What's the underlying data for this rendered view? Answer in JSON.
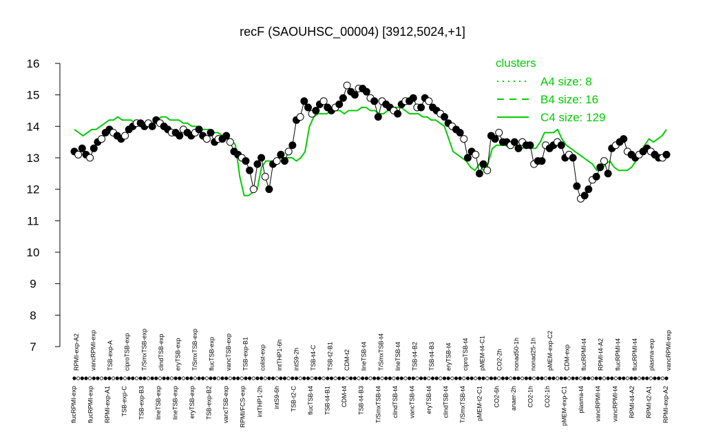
{
  "chart_data": {
    "type": "line",
    "title": "recF (SAOUHSC_00004) [3912,5024,+1]",
    "xlabel": "",
    "ylabel": "",
    "ylim": [
      7,
      16
    ],
    "yticks": [
      7,
      8,
      9,
      10,
      11,
      12,
      13,
      14,
      15,
      16
    ],
    "grid": false,
    "legend_position": "top-right",
    "legend": {
      "title": "clusters",
      "entries": [
        {
          "label": "A4 size: 8",
          "style": "dotted",
          "color": "#00cc00"
        },
        {
          "label": "B4 size: 16",
          "style": "dashed",
          "color": "#00cc00"
        },
        {
          "label": "C4 size: 129",
          "style": "solid",
          "color": "#00cc00"
        }
      ]
    },
    "colors": {
      "points_filled": "#000000",
      "points_open": "#ffffff",
      "line": "#000000",
      "cluster": "#00cc00"
    },
    "x_labels_top": [
      "RPMI-exp-A2",
      "vancRPMI-exp",
      "TSB-exp-A",
      "ciproTSB-exp",
      "T/SmxTSB-exp",
      "clindTSB-exp",
      "eryTSB-exp",
      "T/SmxTSB-exp",
      "flucTSB-exp",
      "vancTSB-exp",
      "TSB-exp-B1",
      "colist-exp",
      "intTHP1-6h",
      "intS9-2h",
      "TSB-t4-C",
      "TSB-t2-B1",
      "CDM-t2",
      "lineTSB-t4",
      "T/SmxTSB-t4",
      "lineTSB-t4",
      "TSB-t4-B2",
      "TSB-t4-B3",
      "eryTSB-t4",
      "ciproTSB-t4",
      "pMEM-t4-C1",
      "CO2-2h",
      "nonad50-1h",
      "nonad25-1h",
      "pMEM-exp-C2",
      "CDM-exp",
      "flucRPMI-t4",
      "RPMI-t4-A2",
      "flucRPMI-t4",
      "flucRPMI-t4",
      "plasma-exp",
      "vancRPMI-exp"
    ],
    "x_labels_bottom": [
      "flucRPMI-exp",
      "flucRPMI-exp",
      "RPMI-exp-A1",
      "TSB-exp-C",
      "TSB-exp-B3",
      "lineTSB-exp",
      "lineTSB-exp",
      "eryTSB-exp",
      "TSB-exp-B2",
      "vancTSB-exp",
      "RPMI/FCS-exp",
      "intTHP1-2h",
      "intS9-6h",
      "TSB-t2-C",
      "flucTSB-t4",
      "TSB-t4-B1",
      "CDM-t4",
      "TSB-t4-B3",
      "T/SmxTSB-t4",
      "clindTSB-t4",
      "vancTSB-t4",
      "eryTSB-t4",
      "clindTSB-t4",
      "T/SmxTSB-t4",
      "pMEM-t2-C1",
      "CO2-6h",
      "anaer-2h",
      "CO2-1h",
      "CO2-1h",
      "pMEM-exp-C1",
      "plasma-t4",
      "vancRPMI-t4",
      "vancRPMI-t4",
      "RPMI-t4-A2",
      "RPMI-t2-A1",
      "RPMI-exp-A2"
    ],
    "x": [
      1,
      2,
      3,
      4,
      5,
      6,
      7,
      8,
      9,
      10,
      11,
      12,
      13,
      14,
      15,
      16,
      17,
      18,
      19,
      20,
      21,
      22,
      23,
      24,
      25,
      26,
      27,
      28,
      29,
      30,
      31,
      32,
      33,
      34,
      35,
      36,
      37,
      38,
      39,
      40,
      41,
      42,
      43,
      44,
      45,
      46,
      47,
      48,
      49,
      50,
      51,
      52,
      53,
      54,
      55,
      56,
      57,
      58,
      59,
      60,
      61,
      62,
      63,
      64,
      65,
      66,
      67,
      68,
      69,
      70,
      71,
      72,
      73,
      74,
      75,
      76,
      77,
      78,
      79,
      80,
      81,
      82,
      83,
      84,
      85,
      86,
      87,
      88,
      89,
      90,
      91,
      92,
      93,
      94,
      95,
      96,
      97,
      98,
      99,
      100,
      101,
      102,
      103,
      104,
      105,
      106,
      107,
      108,
      109,
      110,
      111,
      112,
      113,
      114,
      115,
      116,
      117,
      118,
      119,
      120,
      121,
      122,
      123,
      124,
      125,
      126,
      127,
      128,
      129,
      130,
      131,
      132,
      133,
      134,
      135,
      136,
      137,
      138,
      139,
      140,
      141,
      142,
      143,
      144,
      145,
      146,
      147,
      148,
      149,
      150,
      151,
      152,
      153
    ],
    "series": [
      {
        "values": [
          13.2,
          13.1,
          13.3,
          13.1,
          13.0,
          13.3,
          13.5,
          13.6,
          13.8,
          13.9,
          13.8,
          13.7,
          13.6,
          13.7,
          13.9,
          14.0,
          14.1,
          14.1,
          14.0,
          14.1,
          14.0,
          14.2,
          14.1,
          14.0,
          13.9,
          13.8,
          13.8,
          13.7,
          13.9,
          13.8,
          13.7,
          13.8,
          13.9,
          13.7,
          13.6,
          13.8,
          13.5,
          13.6,
          13.6,
          13.7,
          13.5,
          13.2,
          13.1,
          13.0,
          12.9,
          12.6,
          12.0,
          12.8,
          13.0,
          12.4,
          12.0,
          12.8,
          12.9,
          13.1,
          12.9,
          13.2,
          13.4,
          14.2,
          14.3,
          14.8,
          14.6,
          14.4,
          14.5,
          14.7,
          14.8,
          14.6,
          14.5,
          14.6,
          14.7,
          14.9,
          15.3,
          15.1,
          15.0,
          15.2,
          15.2,
          15.1,
          14.9,
          14.8,
          14.3,
          14.8,
          14.7,
          14.6,
          14.5,
          14.4,
          14.7,
          14.8,
          14.8,
          14.9,
          14.6,
          14.6,
          14.9,
          14.8,
          14.6,
          14.5,
          14.4,
          14.3,
          14.1,
          14.0,
          13.9,
          13.8,
          13.6,
          13.0,
          13.2,
          13.1,
          12.5,
          12.8,
          12.6,
          13.7,
          13.6,
          13.8,
          13.5,
          13.5,
          13.4,
          13.5,
          13.3,
          13.5,
          13.4,
          13.4,
          12.8,
          12.9,
          12.9,
          13.4,
          13.3,
          13.4,
          13.5,
          13.4,
          13.0,
          13.1,
          13.0,
          12.1,
          11.7,
          11.8,
          12.0,
          12.3,
          12.4,
          12.7,
          12.9,
          12.5,
          13.3,
          13.4,
          13.5,
          13.6,
          13.2,
          13.1,
          13.0,
          13.1,
          13.2,
          13.3,
          13.2,
          13.1,
          13.0,
          13.0,
          13.1
        ]
      }
    ],
    "cluster_lines": {
      "C4": [
        13.9,
        13.8,
        13.7,
        13.8,
        13.9,
        13.9,
        14.0,
        14.1,
        14.2,
        14.2,
        14.3,
        14.2,
        14.2,
        14.2,
        14.1,
        14.0,
        14.1,
        14.1,
        14.1,
        14.2,
        14.3,
        14.3,
        14.2,
        14.2,
        14.2,
        14.1,
        14.1,
        14.0,
        14.0,
        13.9,
        13.9,
        13.9,
        13.8,
        13.8,
        13.7,
        13.6,
        13.6,
        13.4,
        12.4,
        11.8,
        11.8,
        11.9,
        12.0,
        12.7,
        12.9,
        12.9,
        12.8,
        13.0,
        13.0,
        13.0,
        13.0,
        12.9,
        13.0,
        13.2,
        14.0,
        14.3,
        14.4,
        14.4,
        14.4,
        14.5,
        14.5,
        14.5,
        14.4,
        14.5,
        14.5,
        14.5,
        14.6,
        14.6,
        14.5,
        14.5,
        14.4,
        14.4,
        14.5,
        14.6,
        14.6,
        14.6,
        14.5,
        14.4,
        14.4,
        14.4,
        14.3,
        14.3,
        14.2,
        14.2,
        14.1,
        14.0,
        13.6,
        13.2,
        13.1,
        13.0,
        12.9,
        12.7,
        12.6,
        12.8,
        12.6,
        12.8,
        13.3,
        13.4,
        13.4,
        13.4,
        13.3,
        13.4,
        13.4,
        13.3,
        13.4,
        13.3,
        13.3,
        13.5,
        13.8,
        13.8,
        13.8,
        13.9,
        13.6,
        13.4,
        13.3,
        13.2,
        13.1,
        13.0,
        12.9,
        12.8,
        12.6,
        12.6,
        12.8,
        12.9,
        12.7,
        12.6,
        12.6,
        12.6,
        12.7,
        12.9,
        13.2,
        13.4,
        13.6,
        13.5,
        13.6,
        13.7,
        13.9
      ]
    }
  }
}
